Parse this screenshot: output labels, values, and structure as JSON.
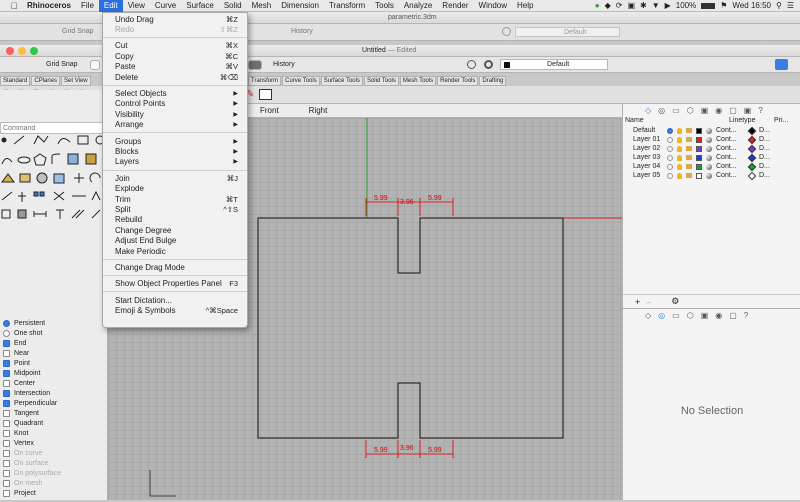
{
  "menubar": {
    "app": "Rhinoceros",
    "items": [
      "File",
      "Edit",
      "View",
      "Curve",
      "Surface",
      "Solid",
      "Mesh",
      "Dimension",
      "Transform",
      "Tools",
      "Analyze",
      "Render",
      "Window",
      "Help"
    ],
    "battery": "100%",
    "clock": "Wed 16:50"
  },
  "back_window": {
    "title": "parametric.3dm",
    "grid_snap": "Grid Snap",
    "history": "History",
    "layer": "Default"
  },
  "front_window": {
    "title": "Untitled",
    "title_status": "— Edited",
    "grid_snap": "Grid Snap",
    "history": "History",
    "layer": "Default",
    "tool_tabs_left": [
      "Standard",
      "CPlanes",
      "Set View"
    ],
    "tool_tabs_right": [
      "Transform",
      "Curve Tools",
      "Surface Tools",
      "Solid Tools",
      "Mesh Tools",
      "Render Tools",
      "Drafting"
    ]
  },
  "command_placeholder": "Command",
  "view_tabs": [
    "Front",
    "Right"
  ],
  "osnap": [
    {
      "label": "Persistent",
      "kind": "radio",
      "checked": true,
      "enabled": true
    },
    {
      "label": "One shot",
      "kind": "radio",
      "checked": false,
      "enabled": true
    },
    {
      "label": "End",
      "kind": "check",
      "checked": true,
      "enabled": true
    },
    {
      "label": "Near",
      "kind": "check",
      "checked": false,
      "enabled": true
    },
    {
      "label": "Point",
      "kind": "check",
      "checked": true,
      "enabled": true
    },
    {
      "label": "Midpoint",
      "kind": "check",
      "checked": true,
      "enabled": true
    },
    {
      "label": "Center",
      "kind": "check",
      "checked": false,
      "enabled": true
    },
    {
      "label": "Intersection",
      "kind": "check",
      "checked": true,
      "enabled": true
    },
    {
      "label": "Perpendicular",
      "kind": "check",
      "checked": true,
      "enabled": true
    },
    {
      "label": "Tangent",
      "kind": "check",
      "checked": false,
      "enabled": true
    },
    {
      "label": "Quadrant",
      "kind": "check",
      "checked": false,
      "enabled": true
    },
    {
      "label": "Knot",
      "kind": "check",
      "checked": false,
      "enabled": true
    },
    {
      "label": "Vertex",
      "kind": "check",
      "checked": false,
      "enabled": true
    },
    {
      "label": "On curve",
      "kind": "check",
      "checked": false,
      "enabled": false
    },
    {
      "label": "On surface",
      "kind": "check",
      "checked": false,
      "enabled": false
    },
    {
      "label": "On polysurface",
      "kind": "check",
      "checked": false,
      "enabled": false
    },
    {
      "label": "On mesh",
      "kind": "check",
      "checked": false,
      "enabled": false
    },
    {
      "label": "Project",
      "kind": "check",
      "checked": false,
      "enabled": true
    }
  ],
  "layers": {
    "headers": {
      "name": "Name",
      "linetype": "Linetype",
      "print": "Pri..."
    },
    "rows": [
      {
        "name": "Default",
        "linetype": "Cont...",
        "print": "D...",
        "color": "#000000",
        "current": true
      },
      {
        "name": "Layer 01",
        "linetype": "Cont...",
        "print": "D...",
        "color": "#e02020",
        "current": false
      },
      {
        "name": "Layer 02",
        "linetype": "Cont...",
        "print": "D...",
        "color": "#7a3cc8",
        "current": false
      },
      {
        "name": "Layer 03",
        "linetype": "Cont...",
        "print": "D...",
        "color": "#1a3ad8",
        "current": false
      },
      {
        "name": "Layer 04",
        "linetype": "Cont...",
        "print": "D...",
        "color": "#18a030",
        "current": false
      },
      {
        "name": "Layer 05",
        "linetype": "Cont...",
        "print": "D...",
        "color": "#ffffff",
        "current": false
      }
    ]
  },
  "properties": {
    "empty_text": "No Selection"
  },
  "dimensions": {
    "left": "5.99",
    "mid": "3.96",
    "right": "5.99"
  },
  "edit_menu": [
    {
      "label": "Undo Drag",
      "shortcut": "⌘Z",
      "enabled": true
    },
    {
      "label": "Redo",
      "shortcut": "⇧⌘Z",
      "enabled": false
    },
    {
      "sep": true
    },
    {
      "label": "Cut",
      "shortcut": "⌘X",
      "enabled": true
    },
    {
      "label": "Copy",
      "shortcut": "⌘C",
      "enabled": true
    },
    {
      "label": "Paste",
      "shortcut": "⌘V",
      "enabled": true
    },
    {
      "label": "Delete",
      "shortcut": "⌘⌫",
      "enabled": true
    },
    {
      "sep": true
    },
    {
      "label": "Select Objects",
      "submenu": true,
      "enabled": true
    },
    {
      "label": "Control Points",
      "submenu": true,
      "enabled": true
    },
    {
      "label": "Visibility",
      "submenu": true,
      "enabled": true
    },
    {
      "label": "Arrange",
      "submenu": true,
      "enabled": true
    },
    {
      "sep": true
    },
    {
      "label": "Groups",
      "submenu": true,
      "enabled": true
    },
    {
      "label": "Blocks",
      "submenu": true,
      "enabled": true
    },
    {
      "label": "Layers",
      "submenu": true,
      "enabled": true
    },
    {
      "sep": true
    },
    {
      "label": "Join",
      "shortcut": "⌘J",
      "enabled": true
    },
    {
      "label": "Explode",
      "enabled": true
    },
    {
      "label": "Trim",
      "shortcut": "⌘T",
      "enabled": true
    },
    {
      "label": "Split",
      "shortcut": "^⇧S",
      "enabled": true
    },
    {
      "label": "Rebuild",
      "enabled": true
    },
    {
      "label": "Change Degree",
      "enabled": true
    },
    {
      "label": "Adjust End Bulge",
      "enabled": true
    },
    {
      "label": "Make Periodic",
      "enabled": true
    },
    {
      "sep": true
    },
    {
      "label": "Change Drag Mode",
      "enabled": true
    },
    {
      "sep": true
    },
    {
      "label": "Show Object Properties Panel",
      "shortcut": "F3",
      "enabled": true
    },
    {
      "sep": true
    },
    {
      "label": "Start Dictation...",
      "enabled": true
    },
    {
      "label": "Emoji & Symbols",
      "shortcut": "^⌘Space",
      "enabled": true
    }
  ]
}
